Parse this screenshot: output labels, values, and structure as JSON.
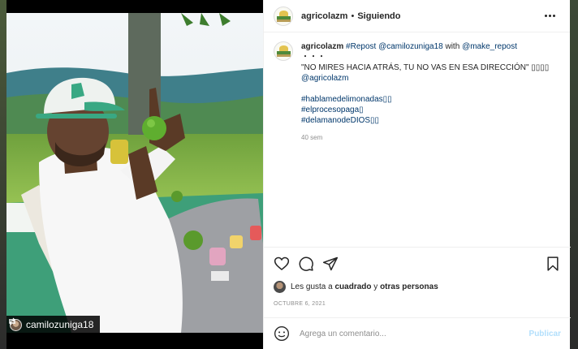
{
  "header": {
    "username": "agricolazm",
    "separator": "•",
    "follow_status": "Siguiendo"
  },
  "photo": {
    "repost_user": "camilozuniga18",
    "repost_icon": "repost-icon"
  },
  "caption": {
    "username": "agricolazm",
    "hashtag_repost": "#Repost",
    "mention_source": "@camilozuniga18",
    "with_text": "with",
    "mention_app": "@make_repost",
    "dots": "・・・",
    "quote": "\"NO MIRES HACIA ATRÁS, TU NO VAS EN ESA DIRECCIÓN\" ▯▯▯▯",
    "mention": "@agricolazm",
    "hashtags": [
      "#hablamedelimonadas▯▯",
      "#elprocesopaga▯",
      "#delamanodeDIOS▯▯"
    ],
    "time_ago": "40 sem"
  },
  "actions": {
    "icons": [
      "heart-icon",
      "comment-icon",
      "share-icon",
      "bookmark-icon"
    ]
  },
  "likes": {
    "prefix": "Les gusta a",
    "liker": "cuadrado",
    "connector": "y",
    "others": "otras personas"
  },
  "date": "OCTUBRE 6, 2021",
  "comment_box": {
    "placeholder": "Agrega un comentario...",
    "post_label": "Publicar"
  },
  "colors": {
    "link": "#00376b",
    "muted": "#8e8e8e",
    "publish_disabled": "#b2dffc"
  }
}
